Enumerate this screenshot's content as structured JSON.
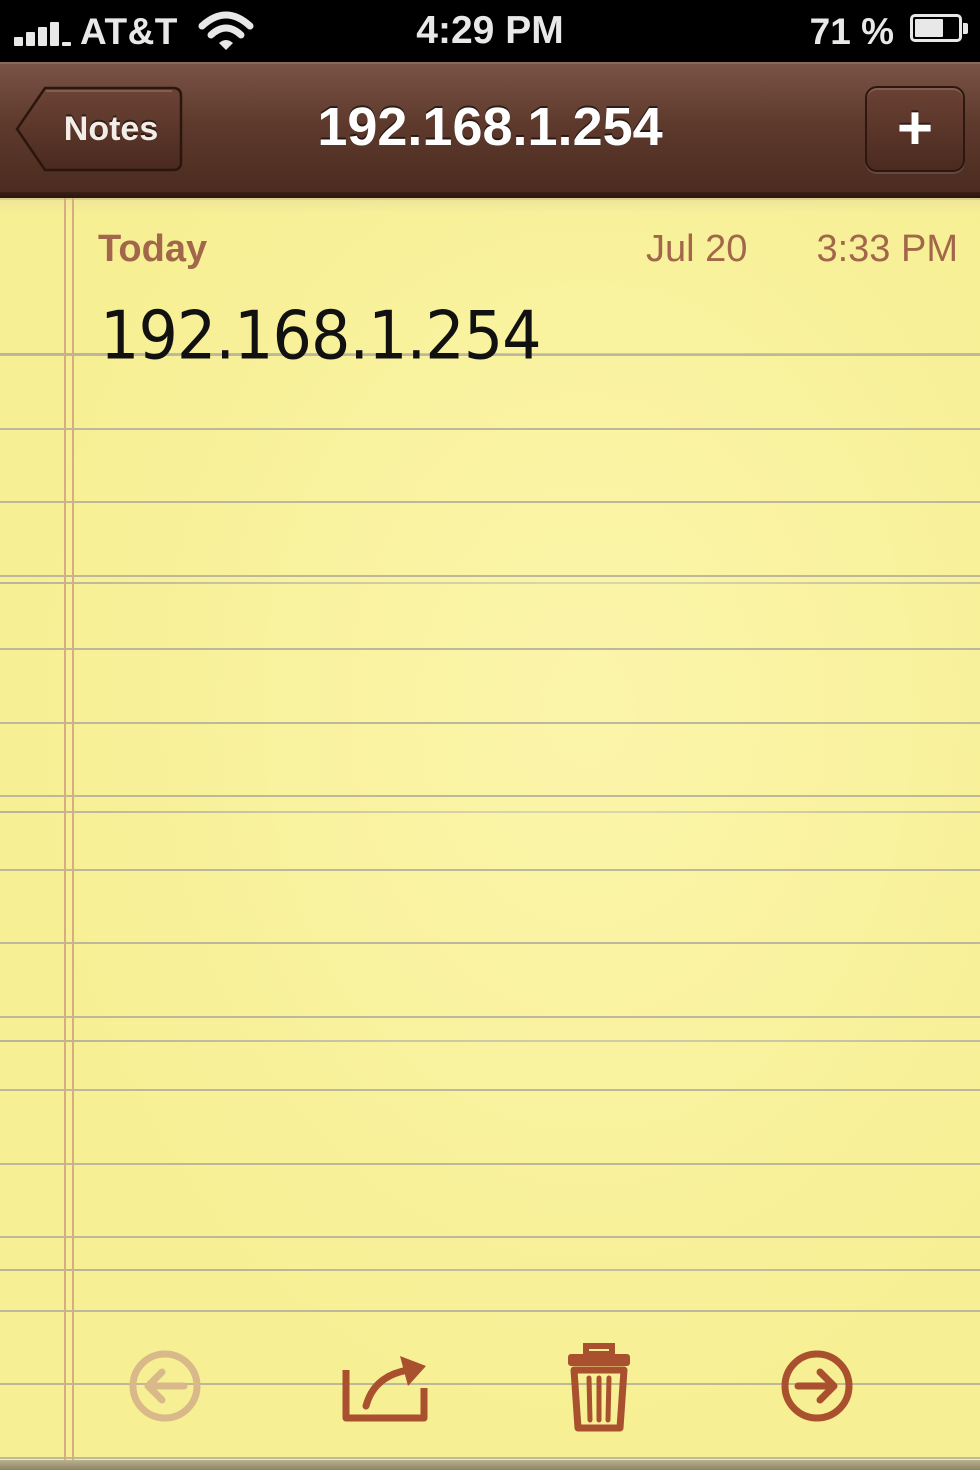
{
  "status_bar": {
    "carrier": "AT&T",
    "time": "4:29 PM",
    "battery_percent": "71 %",
    "battery_level": 0.71,
    "signal_bars": 4
  },
  "nav_bar": {
    "back_label": "Notes",
    "title": "192.168.1.254",
    "add_label": "+"
  },
  "note": {
    "day": "Today",
    "date": "Jul 20",
    "time": "3:33 PM",
    "body": "192.168.1.254"
  },
  "toolbar": {
    "icons": [
      "previous-note-icon",
      "share-icon",
      "trash-icon",
      "next-note-icon"
    ],
    "previous_enabled": false
  },
  "colors": {
    "paper": "#f7ef93",
    "leather": "#5e3a2d",
    "accent_text": "#a2664a",
    "icon_active": "#a9512f",
    "icon_disabled": "#d9b98a",
    "margin_line": "#d7ac83"
  }
}
